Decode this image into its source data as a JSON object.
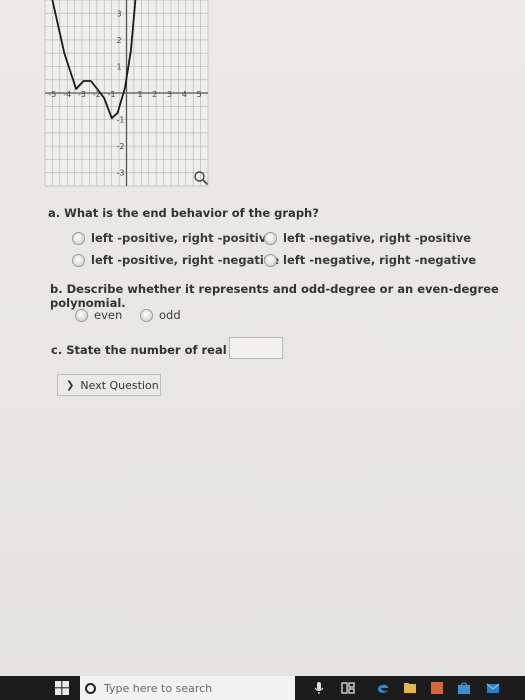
{
  "graph": {
    "x_ticks": [
      "-5",
      "-4",
      "-3",
      "-2",
      "-1",
      "1",
      "2",
      "3",
      "4",
      "5"
    ],
    "y_ticks": [
      "3",
      "2",
      "1",
      "-1",
      "-2",
      "-3"
    ]
  },
  "question_a": {
    "label": "a. What is the end behavior of the graph?",
    "options": [
      "left -positive, right -positive",
      "left -negative, right -positive",
      "left -positive, right -negative",
      "left -negative, right -negative"
    ]
  },
  "question_b": {
    "label": "b. Describe whether it represents and odd-degree or an even-degree polynomial.",
    "options": [
      "even",
      "odd"
    ]
  },
  "question_c": {
    "label": "c. State the number of real zeros:",
    "value": ""
  },
  "next_button": {
    "label": "Next Question"
  },
  "taskbar": {
    "search_placeholder": "Type here to search"
  }
}
